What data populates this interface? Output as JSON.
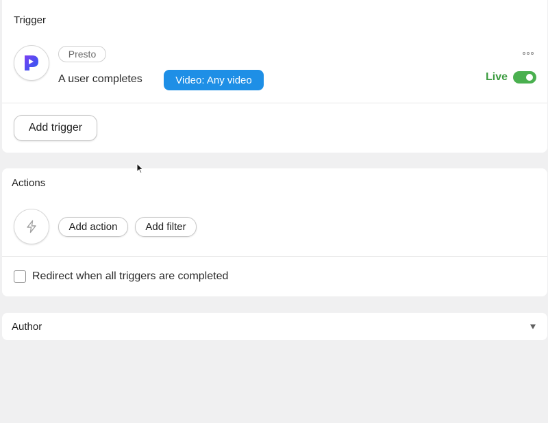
{
  "trigger": {
    "title": "Trigger",
    "integration_name": "Presto",
    "integration_icon": "presto-logo-icon",
    "description": "A user completes",
    "condition_badge": "Video: Any video",
    "status_label": "Live",
    "status_on": true,
    "accent_color": "#1e8fe6",
    "live_color": "#3b9b3f",
    "add_button_label": "Add trigger"
  },
  "actions": {
    "title": "Actions",
    "placeholder_icon": "bolt-icon",
    "add_action_label": "Add action",
    "add_filter_label": "Add filter",
    "redirect_label": "Redirect when all triggers are completed",
    "redirect_checked": false
  },
  "author": {
    "title": "Author"
  }
}
